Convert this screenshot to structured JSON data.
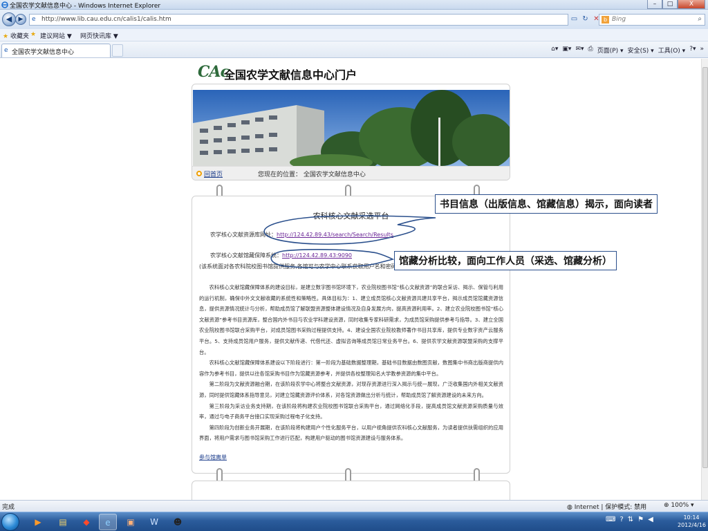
{
  "window": {
    "title": "全国农学文献信息中心 - Windows Internet Explorer",
    "controls": {
      "minimize": "–",
      "maximize": "□",
      "close": "X"
    }
  },
  "address": {
    "url": "http://www.lib.cau.edu.cn/calis1/calis.htm",
    "search_placeholder": "Bing",
    "back": "◀",
    "forward": "▶"
  },
  "favorites": {
    "label": "收藏夹",
    "items": [
      "建议网站 ▼",
      "网页快讯库 ▼"
    ]
  },
  "tab": {
    "label": "全国农学文献信息中心"
  },
  "commandbar": {
    "items": [
      "▾",
      "▾",
      "▾",
      "页面(P) ▾",
      "安全(S) ▾",
      "工具(O) ▾",
      "?▾",
      "»"
    ]
  },
  "site": {
    "logo_text": "CAc",
    "title": "全国农学文献信息中心门户",
    "breadcrumb_home": "回首页",
    "breadcrumb_location": "您现在的位置：  全国农学文献信息中心"
  },
  "content": {
    "title": "农科核心文献采选平台",
    "line1_label": "农学核心文献资源库网址：",
    "line1_url": "http://124.42.89.43/search/Search/Results",
    "line2_label": "农学核心文献馆藏保障系统：",
    "line2_url": "http://124.42.89.43:9090",
    "note": "(该系统面对各农科院校图书馆提供服务,各馆可与农学中心联系获取用户名和密码)",
    "paragraphs": [
      "农科核心文献馆藏保障体系的建设目标，是建立数字图书馆环境下，农业院校图书馆“核心文献资源”的联合采访、揭示、保管与利用的运行机制，确保中外文文献收藏的系统性和策略性。具体目标为：1、建立成员馆核心文献资源共建共享平台，揭示成员馆馆藏资源信息，提供资源情况统计与分析，帮助成员馆了解联盟资源整体建设情况及自身发展方向，提高资源利用率。2、建立农业院校图书馆“核心文献资源”参考书目资源库，整合国内外书目与农业学科建设资源，同时收集专家科研需求，为成员馆采购提供参考与指导。3、建立全国农业院校图书馆联合采购平台，对成员馆图书采购过程提供支持。4、建设全国农业院校教师著作书目共享库，提供专业数字资产云服务平台。5、支持成员馆用户服务，提供文献传递、代借代还、虚拟咨询等成员馆日常业务平台。6、提供农学文献资源联盟采购的支撑平台。",
      "农科核心文献馆藏保障体系建设以下阶段进行：第一阶段为基础数据整理期，基础书目数据由数图贡献，数图集中书商出版商提供内容作为参考书目，提供以往各馆采购书目作为馆藏资源参考，并提供各校整理知名大学教参资源的集中平台。",
      "第二阶段为文献资源融合期，在该阶段农学中心将整合文献资源，对现存资源进行深入揭示与统一展现，广泛收集国内外相关文献资源，同时提供馆藏体系指导意见，对建立馆藏资源评价体系，对各馆资源做出分析与统计，帮助成员馆了解资源建设的未来方向。",
      "第三阶段为采访业务支持期，在该阶段将构建农业院校图书馆联合采购平台，通过网络化手段，提高成员馆文献资源采购质量与效率，通过与电子商务平台接口实现采购过程电子化支持。",
      "第四阶段为创新业务开展期，在该阶段将构建用户个性化服务平台，以用户视角提供农科核心文献服务，为读者提供扶需组织的应用界面，将用户需求与图书馆采购工作进行匹配，构建用户驱动的图书馆资源建设与服务体系。"
    ],
    "bottom_link": "参与馆离单"
  },
  "callouts": {
    "first": "书目信息（出版信息、馆藏信息）揭示，面向读者",
    "second": "馆藏分析比较，面向工作人员（采选、馆藏分析）"
  },
  "status": {
    "left": "完成",
    "zone": "Internet | 保护模式: 禁用",
    "zoom": "100%"
  },
  "taskbar": {
    "time": "10:14",
    "date": "2012/4/16"
  },
  "colors": {
    "link": "#1a3b8a",
    "visited_link": "#6a2596",
    "callout_border": "#2a4f8c",
    "taskbar": "#2b5c9c"
  }
}
